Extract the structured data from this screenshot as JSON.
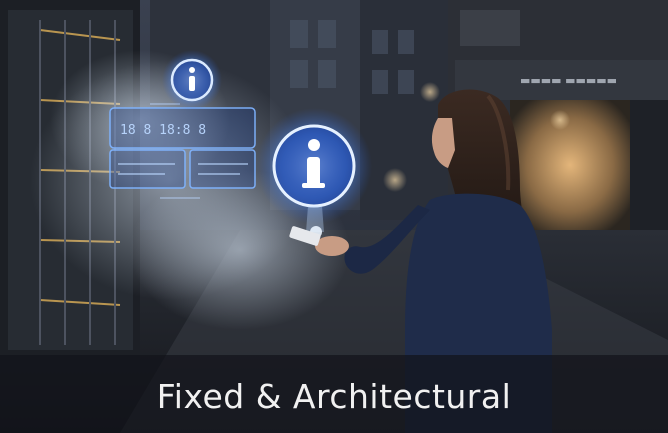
{
  "caption": {
    "text": "Fixed & Architectural"
  },
  "scene": {
    "description_icons": [
      "info-icon",
      "info-icon"
    ],
    "colors": {
      "glow": "#9cc8ff",
      "panel_glow": "#3f7fff",
      "caption_bar": "#12141a",
      "caption_text": "#f1f1f1"
    }
  }
}
